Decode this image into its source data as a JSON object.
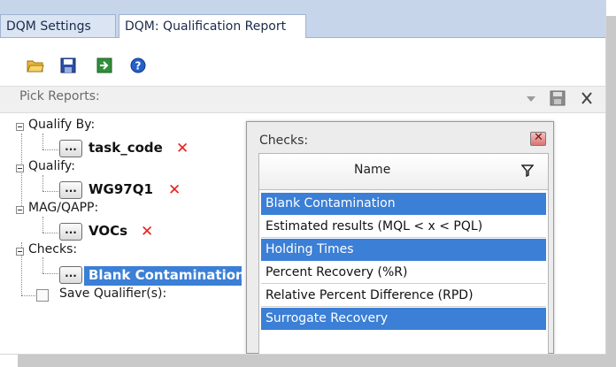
{
  "tabs": [
    {
      "label": "DQM Settings",
      "active": false
    },
    {
      "label": "DQM: Qualification Report",
      "active": true
    }
  ],
  "toolbar": {
    "icons": [
      "folder-open-icon",
      "save-icon",
      "export-icon",
      "help-icon"
    ]
  },
  "pick_reports": {
    "label": "Pick Reports:"
  },
  "tree": {
    "qualify_by": {
      "label": "Qualify By:",
      "value": "task_code"
    },
    "qualify": {
      "label": "Qualify:",
      "value": "WG97Q1"
    },
    "mag_qapp": {
      "label": "MAG/QAPP:",
      "value": "VOCs"
    },
    "checks": {
      "label": "Checks:",
      "value": "Blank Contamination"
    },
    "save_qualifier": {
      "label": "Save Qualifier(s):",
      "checked": false
    },
    "ellipsis_label": "..."
  },
  "checks_popup": {
    "title": "Checks:",
    "column_header": "Name",
    "rows": [
      {
        "label": "Blank Contamination",
        "selected": true
      },
      {
        "label": "Estimated results (MQL < x < PQL)",
        "selected": false
      },
      {
        "label": "Holding Times",
        "selected": true
      },
      {
        "label": "Percent Recovery (%R)",
        "selected": false
      },
      {
        "label": "Relative Percent Difference (RPD)",
        "selected": false
      },
      {
        "label": "Surrogate Recovery",
        "selected": true
      }
    ]
  },
  "colors": {
    "selection": "#3b7fd6",
    "remove_x": "#e8201b",
    "tab_strip": "#c7d5ea"
  }
}
